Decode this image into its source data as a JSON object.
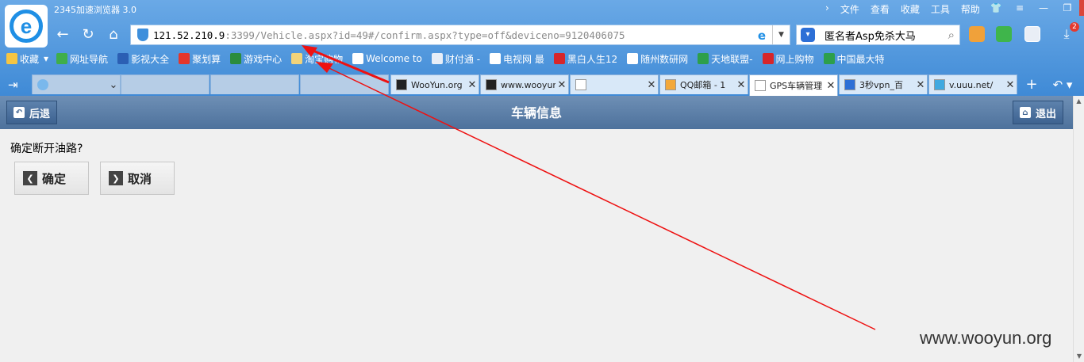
{
  "window": {
    "title": "2345加速浏览器 3.0"
  },
  "menu": [
    "文件",
    "查看",
    "收藏",
    "工具",
    "帮助"
  ],
  "address": {
    "host": "121.52.210.9",
    "rest": ":3399/Vehicle.aspx?id=49#/confirm.aspx?type=off&deviceno=9120406075"
  },
  "search": {
    "value": "匿名者Asp免杀大马"
  },
  "notification_count": "2",
  "bookmarks": [
    {
      "label": "收藏",
      "icon": "star-icon",
      "color": "#f5c542"
    },
    {
      "label": "网址导航",
      "icon": "house-icon",
      "color": "#3fae49"
    },
    {
      "label": "影视大全",
      "icon": "film-icon",
      "color": "#2b5fb4"
    },
    {
      "label": "聚划算",
      "icon": "juhuasuan-icon",
      "color": "#e4362b"
    },
    {
      "label": "游戏中心",
      "icon": "game-icon",
      "color": "#2b8c3d"
    },
    {
      "label": "淘宝购物",
      "icon": "folder-icon",
      "color": "#f2d37a"
    },
    {
      "label": "Welcome to",
      "icon": "page-icon",
      "color": "#ffffff"
    },
    {
      "label": "财付通 -",
      "icon": "tenpay-icon",
      "color": "#e8eef7"
    },
    {
      "label": "电视网 最",
      "icon": "page-icon",
      "color": "#ffffff"
    },
    {
      "label": "黑白人生12",
      "icon": "letv-icon",
      "color": "#d7262a"
    },
    {
      "label": "随州数研网",
      "icon": "page-icon",
      "color": "#ffffff"
    },
    {
      "label": "天地联盟-",
      "icon": "tiandi-icon",
      "color": "#2d9f4b"
    },
    {
      "label": "网上购物",
      "icon": "shop-icon",
      "color": "#d7262a"
    },
    {
      "label": "中国最大特",
      "icon": "te-icon",
      "color": "#2d9f4b"
    }
  ],
  "tabs": [
    {
      "label": "WooYun.org",
      "icon": "wooyun-icon"
    },
    {
      "label": "www.wooyun",
      "icon": "wooyun-icon"
    },
    {
      "label": "",
      "icon": "page-icon"
    },
    {
      "label": "QQ邮箱 - 1",
      "icon": "qqmail-icon"
    },
    {
      "label": "GPS车辆管理",
      "icon": "page-icon"
    },
    {
      "label": "3秒vpn_百",
      "icon": "baidu-icon"
    },
    {
      "label": "v.uuu.net/",
      "icon": "globe-icon"
    }
  ],
  "page": {
    "title": "车辆信息",
    "back_label": "后退",
    "exit_label": "退出",
    "confirm_text": "确定断开油路?",
    "ok_label": "确定",
    "cancel_label": "取消"
  },
  "watermark": "www.wooyun.org"
}
